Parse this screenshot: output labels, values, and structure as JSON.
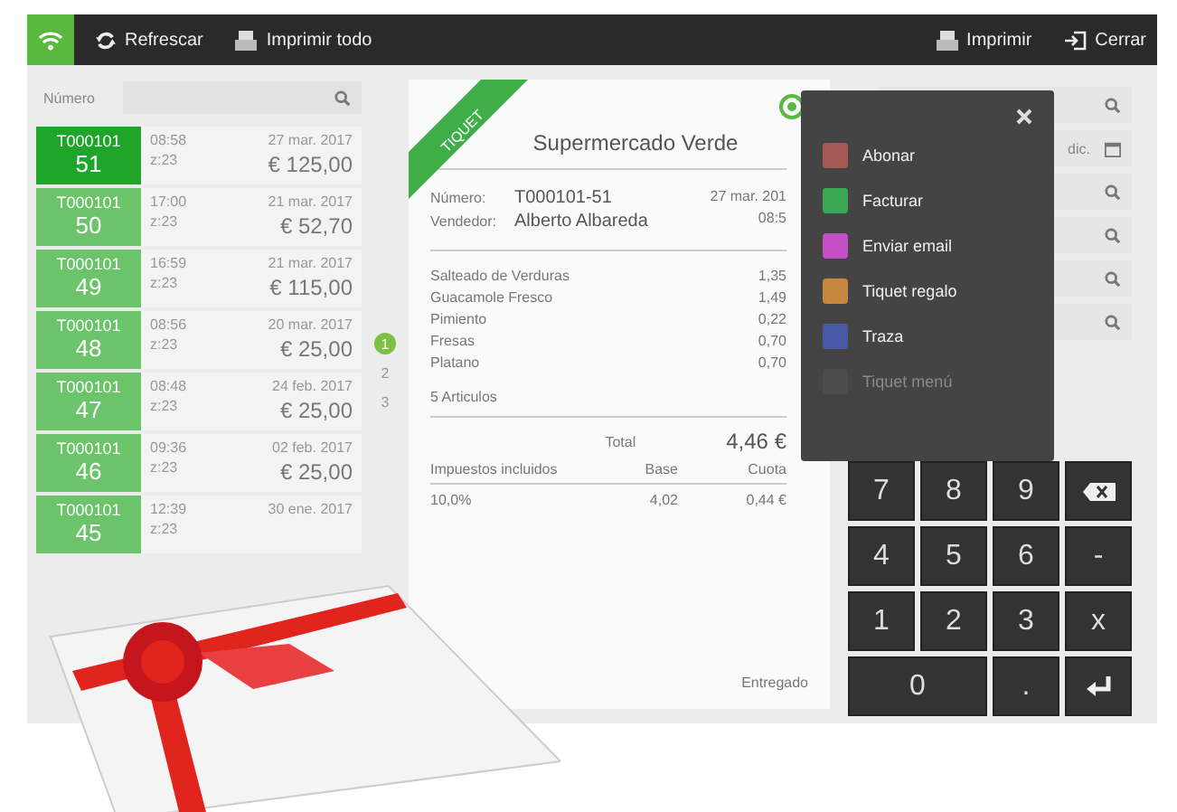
{
  "toolbar": {
    "items": [
      {
        "label": "Refrescar"
      },
      {
        "label": "Imprimir todo"
      },
      {
        "label": "Imprimir"
      },
      {
        "label": "Cerrar"
      }
    ]
  },
  "search": {
    "label": "Número"
  },
  "tickets": [
    {
      "series": "T000101",
      "number": "51",
      "time": "08:58",
      "zone": "z:23",
      "date": "27 mar. 2017",
      "amount": "€ 125,00",
      "selected": true
    },
    {
      "series": "T000101",
      "number": "50",
      "time": "17:00",
      "zone": "z:23",
      "date": "21 mar. 2017",
      "amount": "€ 52,70",
      "selected": false
    },
    {
      "series": "T000101",
      "number": "49",
      "time": "16:59",
      "zone": "z:23",
      "date": "21 mar. 2017",
      "amount": "€ 115,00",
      "selected": false
    },
    {
      "series": "T000101",
      "number": "48",
      "time": "08:56",
      "zone": "z:23",
      "date": "20 mar. 2017",
      "amount": "€ 25,00",
      "selected": false
    },
    {
      "series": "T000101",
      "number": "47",
      "time": "08:48",
      "zone": "z:23",
      "date": "24 feb. 2017",
      "amount": "€ 25,00",
      "selected": false
    },
    {
      "series": "T000101",
      "number": "46",
      "time": "09:36",
      "zone": "z:23",
      "date": "02 feb. 2017",
      "amount": "€ 25,00",
      "selected": false
    },
    {
      "series": "T000101",
      "number": "45",
      "time": "12:39",
      "zone": "z:23",
      "date": "30 ene. 2017",
      "selected": false
    }
  ],
  "pager": [
    {
      "label": "1",
      "selected": true
    },
    {
      "label": "2",
      "selected": false
    },
    {
      "label": "3",
      "selected": false
    }
  ],
  "receipt": {
    "ribbon": "TIQUET",
    "store": "Supermercado Verde",
    "number_label": "Número:",
    "number": "T000101-51",
    "seller_label": "Vendedor:",
    "seller": "Alberto Albareda",
    "date": "27 mar. 201",
    "time": "08:5",
    "lines": [
      {
        "name": "Salteado de Verduras",
        "price": "1,35"
      },
      {
        "name": "Guacamole Fresco",
        "price": "1,49"
      },
      {
        "name": "Pimiento",
        "price": "0,22"
      },
      {
        "name": "Fresas",
        "price": "0,70"
      },
      {
        "name": "Platano",
        "price": "0,70"
      }
    ],
    "count": "5 Articulos",
    "total_label": "Total",
    "total": "4,46 €",
    "tax_header": [
      "Impuestos incluidos",
      "Base",
      "Cuota"
    ],
    "tax_rows": [
      [
        "10,0%",
        "4,02",
        "0,44 €"
      ]
    ],
    "status": "Entregado"
  },
  "menu": {
    "items": [
      {
        "label": "Abonar",
        "color": "#a65a55",
        "disabled": false
      },
      {
        "label": "Facturar",
        "color": "#3aa757",
        "disabled": false
      },
      {
        "label": "Enviar email",
        "color": "#c24ec4",
        "disabled": false
      },
      {
        "label": "Tiquet regalo",
        "color": "#c8873e",
        "disabled": false
      },
      {
        "label": "Traza",
        "color": "#4a5aa8",
        "disabled": false
      },
      {
        "label": "Tiquet menú",
        "color": "#555555",
        "disabled": true
      }
    ]
  },
  "filters": [
    {
      "kind": "search"
    },
    {
      "kind": "date",
      "value": "dic."
    },
    {
      "kind": "search"
    },
    {
      "kind": "search"
    },
    {
      "kind": "search"
    },
    {
      "kind": "search"
    }
  ],
  "keypad": [
    {
      "kind": "digit",
      "label": "7"
    },
    {
      "kind": "digit",
      "label": "8"
    },
    {
      "kind": "digit",
      "label": "9"
    },
    {
      "kind": "backspace"
    },
    {
      "kind": "digit",
      "label": "4"
    },
    {
      "kind": "digit",
      "label": "5"
    },
    {
      "kind": "digit",
      "label": "6"
    },
    {
      "kind": "digit",
      "label": "-"
    },
    {
      "kind": "digit",
      "label": "1"
    },
    {
      "kind": "digit",
      "label": "2"
    },
    {
      "kind": "digit",
      "label": "3"
    },
    {
      "kind": "digit",
      "label": "x"
    },
    {
      "kind": "wide",
      "label": "0"
    },
    {
      "kind": "digit",
      "label": "."
    },
    {
      "kind": "enter"
    }
  ]
}
